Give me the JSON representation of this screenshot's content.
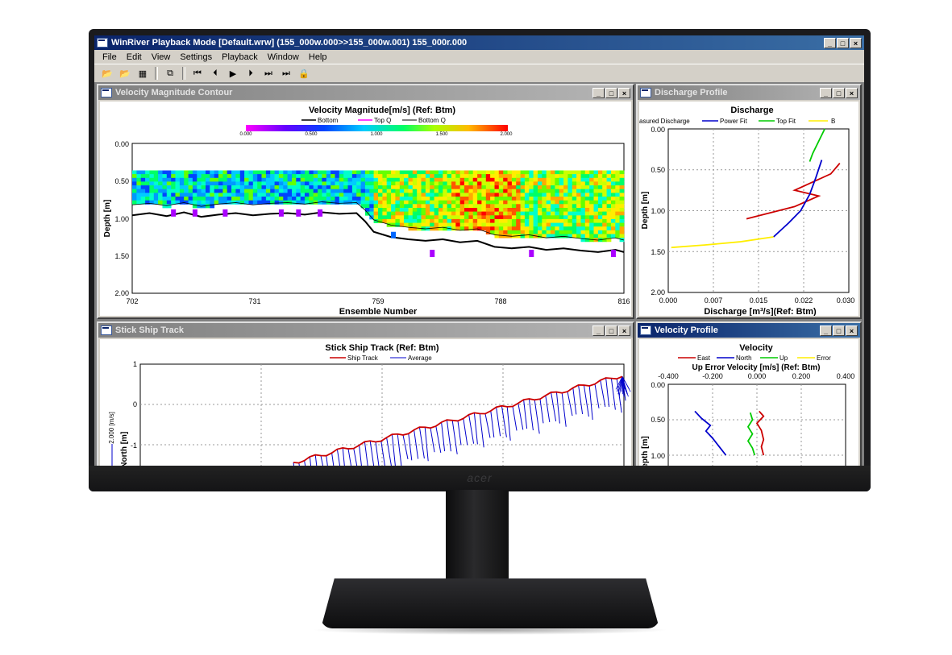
{
  "app": {
    "title": "WinRiver Playback Mode [Default.wrw] (155_000w.000>>155_000w.001) 155_000r.000",
    "window_buttons": [
      "_",
      "□",
      "×"
    ]
  },
  "brand": "acer",
  "menu": [
    "File",
    "Edit",
    "View",
    "Settings",
    "Playback",
    "Window",
    "Help"
  ],
  "toolbar": {
    "icons": [
      "open-folder-icon",
      "open-file-icon",
      "grid-icon",
      "copy-icon",
      "skip-start-icon",
      "step-back-icon",
      "play-icon",
      "step-forward-icon",
      "next-icon",
      "skip-end-icon",
      "lock-icon"
    ],
    "glyphs": [
      "📂",
      "📂",
      "▦",
      "⧉",
      "⏮",
      "⏴",
      "▶",
      "⏵",
      "⏭",
      "⏭",
      "🔒"
    ]
  },
  "colors": {
    "series_red": "#cc0000",
    "series_blue": "#0000cc",
    "series_green": "#00cc00",
    "series_yellow": "#ffee00"
  },
  "windows": {
    "contour": {
      "title": "Velocity Magnitude Contour",
      "chart_title": "Velocity Magnitude[m/s] (Ref: Btm)",
      "legend": [
        "Bottom",
        "Top Q",
        "Bottom Q"
      ],
      "scale_labels": [
        "0.000",
        "0.500",
        "1.000",
        "1.500",
        "2.000"
      ],
      "y_label": "Depth [m]",
      "x_label": "Ensemble Number",
      "y_ticks": [
        "0.00",
        "0.50",
        "1.00",
        "1.50",
        "2.00"
      ],
      "x_ticks": [
        "702",
        "731",
        "759",
        "788",
        "816"
      ]
    },
    "discharge": {
      "title": "Discharge Profile",
      "chart_title": "Discharge",
      "legend": [
        "asured Discharge",
        "Power Fit",
        "Top Fit",
        "B"
      ],
      "y_label": "Depth [m]",
      "x_label": "Discharge [m³/s](Ref: Btm)",
      "y_ticks": [
        "0.00",
        "0.50",
        "1.00",
        "1.50",
        "2.00"
      ],
      "x_ticks": [
        "0.000",
        "0.007",
        "0.015",
        "0.022",
        "0.030"
      ]
    },
    "shiptrack": {
      "title": "Stick Ship Track",
      "chart_title": "Stick Ship Track (Ref: Btm)",
      "legend": [
        "Ship Track",
        "Average"
      ],
      "y_label": "ance North [m]",
      "scale_label": "2.000 [m/s]",
      "y_ticks": [
        "1",
        "0",
        "-1"
      ]
    },
    "velocity": {
      "title": "Velocity Profile",
      "chart_title": "Velocity",
      "legend": [
        "East",
        "North",
        "Up",
        "Error"
      ],
      "x_label_top": "Up Error Velocity [m/s] (Ref: Btm)",
      "x_ticks": [
        "-0.400",
        "-0.200",
        "0.000",
        "0.200",
        "0.400"
      ],
      "y_label": "epth [m]",
      "y_ticks": [
        "0.00",
        "0.50",
        "1.00"
      ]
    }
  },
  "chart_data": [
    {
      "type": "heatmap",
      "title": "Velocity Magnitude[m/s] (Ref: Btm)",
      "xlabel": "Ensemble Number",
      "ylabel": "Depth [m]",
      "xlim": [
        702,
        816
      ],
      "ylim": [
        2.0,
        0.0
      ],
      "color_scale": [
        0.0,
        2.0
      ],
      "series": [
        {
          "name": "Bottom",
          "x": [
            702,
            706,
            710,
            714,
            718,
            722,
            726,
            730,
            734,
            738,
            742,
            746,
            750,
            754,
            756,
            758,
            762,
            766,
            770,
            774,
            778,
            782,
            786,
            790,
            794,
            798,
            802,
            806,
            810,
            814,
            816
          ],
          "y": [
            0.96,
            0.93,
            0.97,
            0.92,
            0.98,
            0.95,
            0.93,
            0.96,
            0.94,
            0.93,
            0.95,
            0.92,
            0.94,
            0.93,
            1.04,
            1.18,
            1.25,
            1.28,
            1.3,
            1.28,
            1.32,
            1.3,
            1.38,
            1.4,
            1.38,
            1.42,
            1.4,
            1.43,
            1.45,
            1.42,
            1.45
          ]
        },
        {
          "name": "Bottom Q",
          "x": [
            702,
            706,
            710,
            714,
            718,
            722,
            726,
            730,
            734,
            738,
            742,
            746,
            750,
            754,
            756,
            758,
            762,
            766,
            770,
            774,
            778,
            782,
            786,
            790,
            794,
            798,
            802,
            806,
            810,
            814,
            816
          ],
          "y": [
            0.82,
            0.8,
            0.83,
            0.79,
            0.84,
            0.81,
            0.79,
            0.82,
            0.8,
            0.79,
            0.81,
            0.78,
            0.8,
            0.79,
            0.89,
            1.02,
            1.09,
            1.12,
            1.14,
            1.12,
            1.16,
            1.14,
            1.22,
            1.24,
            1.22,
            1.26,
            1.24,
            1.27,
            1.29,
            1.26,
            1.29
          ]
        }
      ]
    },
    {
      "type": "line",
      "title": "Discharge",
      "xlabel": "Discharge [m³/s](Ref: Btm)",
      "ylabel": "Depth [m]",
      "xlim": [
        0.0,
        0.03
      ],
      "ylim": [
        2.0,
        0.0
      ],
      "series": [
        {
          "name": "Measured Discharge",
          "x": [
            0.0285,
            0.027,
            0.024,
            0.021,
            0.025,
            0.021,
            0.013
          ],
          "y": [
            0.42,
            0.55,
            0.65,
            0.75,
            0.82,
            0.95,
            1.1
          ]
        },
        {
          "name": "Power Fit",
          "x": [
            0.0255,
            0.0245,
            0.0235,
            0.022,
            0.02,
            0.0175
          ],
          "y": [
            0.38,
            0.6,
            0.8,
            1.0,
            1.15,
            1.32
          ]
        },
        {
          "name": "Top Fit",
          "x": [
            0.026,
            0.025,
            0.024,
            0.0235
          ],
          "y": [
            0.0,
            0.15,
            0.3,
            0.4
          ]
        },
        {
          "name": "B",
          "x": [
            0.0175,
            0.012,
            0.006,
            0.0005
          ],
          "y": [
            1.32,
            1.38,
            1.42,
            1.45
          ]
        }
      ]
    },
    {
      "type": "line",
      "title": "Stick Ship Track (Ref: Btm)",
      "ylabel": "ance North [m]",
      "series": [
        {
          "name": "Ship Track"
        },
        {
          "name": "Average"
        }
      ]
    },
    {
      "type": "line",
      "title": "Velocity",
      "xlabel": "Up Error Velocity [m/s] (Ref: Btm)",
      "ylabel": "epth [m]",
      "xlim": [
        -0.4,
        0.4
      ],
      "ylim": [
        1.2,
        0.0
      ],
      "series": [
        {
          "name": "East",
          "x": [
            0.01,
            0.03,
            0.0,
            0.02,
            0.03,
            0.02,
            0.03
          ],
          "y": [
            0.38,
            0.45,
            0.55,
            0.65,
            0.78,
            0.88,
            1.0
          ]
        },
        {
          "name": "North",
          "x": [
            -0.28,
            -0.25,
            -0.21,
            -0.23,
            -0.2,
            -0.17,
            -0.14
          ],
          "y": [
            0.38,
            0.48,
            0.58,
            0.66,
            0.76,
            0.88,
            1.0
          ]
        },
        {
          "name": "Up",
          "x": [
            -0.03,
            -0.02,
            -0.04,
            -0.02,
            -0.04,
            -0.02,
            -0.01
          ],
          "y": [
            0.4,
            0.5,
            0.6,
            0.7,
            0.8,
            0.9,
            1.0
          ]
        }
      ]
    }
  ]
}
